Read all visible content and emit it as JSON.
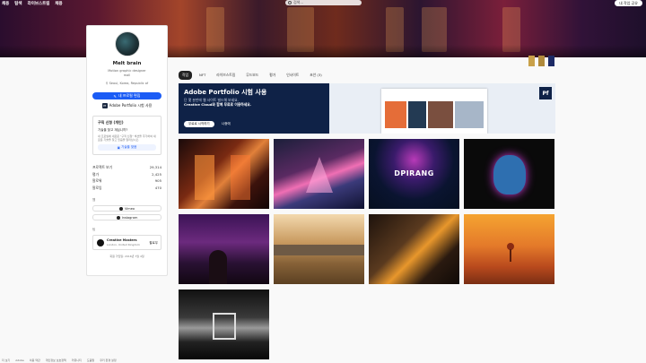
{
  "nav": {
    "links": [
      "채용",
      "탐색",
      "라이브스트림",
      "채용"
    ],
    "search_placeholder": "검색...",
    "share_label": "내 작업 공유"
  },
  "profile": {
    "name": "Melt brain",
    "role_line1": "Motion graphic designer",
    "role_line2": "mall",
    "location": "Seoul, Korea, Republic of",
    "edit_button": "내 프로필 편집",
    "portfolio_button": "Adobe Portfolio 시험 사용",
    "portfolio_icon": "Pf",
    "hire": {
      "title": "구직 신청 (개인)",
      "subtitle": "기술을 찾고 계십니까?",
      "desc": "내 프로필에 새로운 \"구직 신청\" 섹션을 추가하여 새로운 기술을 찾고 있음을 알리십시오.",
      "button": "기술을 찾음"
    },
    "stats": [
      {
        "label": "프로젝트 보기",
        "value": "29,314"
      },
      {
        "label": "평가",
        "value": "2,425"
      },
      {
        "label": "팔로워",
        "value": "905"
      },
      {
        "label": "팔로잉",
        "value": "470"
      }
    ],
    "social_label": "웹",
    "social": [
      {
        "name": "Vimeo"
      },
      {
        "name": "Instagram"
      }
    ],
    "team_label": "팀",
    "team": {
      "name": "Creative Masters",
      "location": "London, United Kingdom",
      "follow": "팔로우"
    },
    "member_since": "회원 가입일: 2016년 7월 4일"
  },
  "badges": [
    {
      "label": "",
      "color": "#c9a14a"
    },
    {
      "label": "",
      "color": "#b08a3c"
    },
    {
      "label": "",
      "color": "#1c2a66"
    }
  ],
  "tabs": [
    {
      "label": "작업",
      "active": true
    },
    {
      "label": "NFT",
      "active": false
    },
    {
      "label": "라이브스트림",
      "active": false
    },
    {
      "label": "무드보드",
      "active": false
    },
    {
      "label": "평가",
      "active": false
    },
    {
      "label": "인사이트",
      "active": false
    },
    {
      "label": "초안 (3)",
      "active": false
    }
  ],
  "promo": {
    "title": "Adobe Portfolio 시험 사용",
    "sub1": "단 몇 분만에 웹 사이트 빌드해 보세요.",
    "sub2": "Creative Cloud와 함께 무료로 이용하세요.",
    "button1": "무료로 시작하기",
    "button2": "나중에",
    "icon": "Pf"
  },
  "gallery": [
    {
      "name": "red-door-scene"
    },
    {
      "name": "neon-alley-scene"
    },
    {
      "name": "dpirang-logo",
      "text": "DPIRANG"
    },
    {
      "name": "neon-creature"
    },
    {
      "name": "girl-purple-scene"
    },
    {
      "name": "city-skyline"
    },
    {
      "name": "dark-landscape"
    },
    {
      "name": "orange-desert-tree"
    },
    {
      "name": "mono-corridor"
    }
  ],
  "footer": [
    "더 보기",
    "Adobe",
    "이용 약관",
    "개인정보 보호정책",
    "커뮤니티",
    "도움말",
    "쿠키 환경 설정"
  ]
}
